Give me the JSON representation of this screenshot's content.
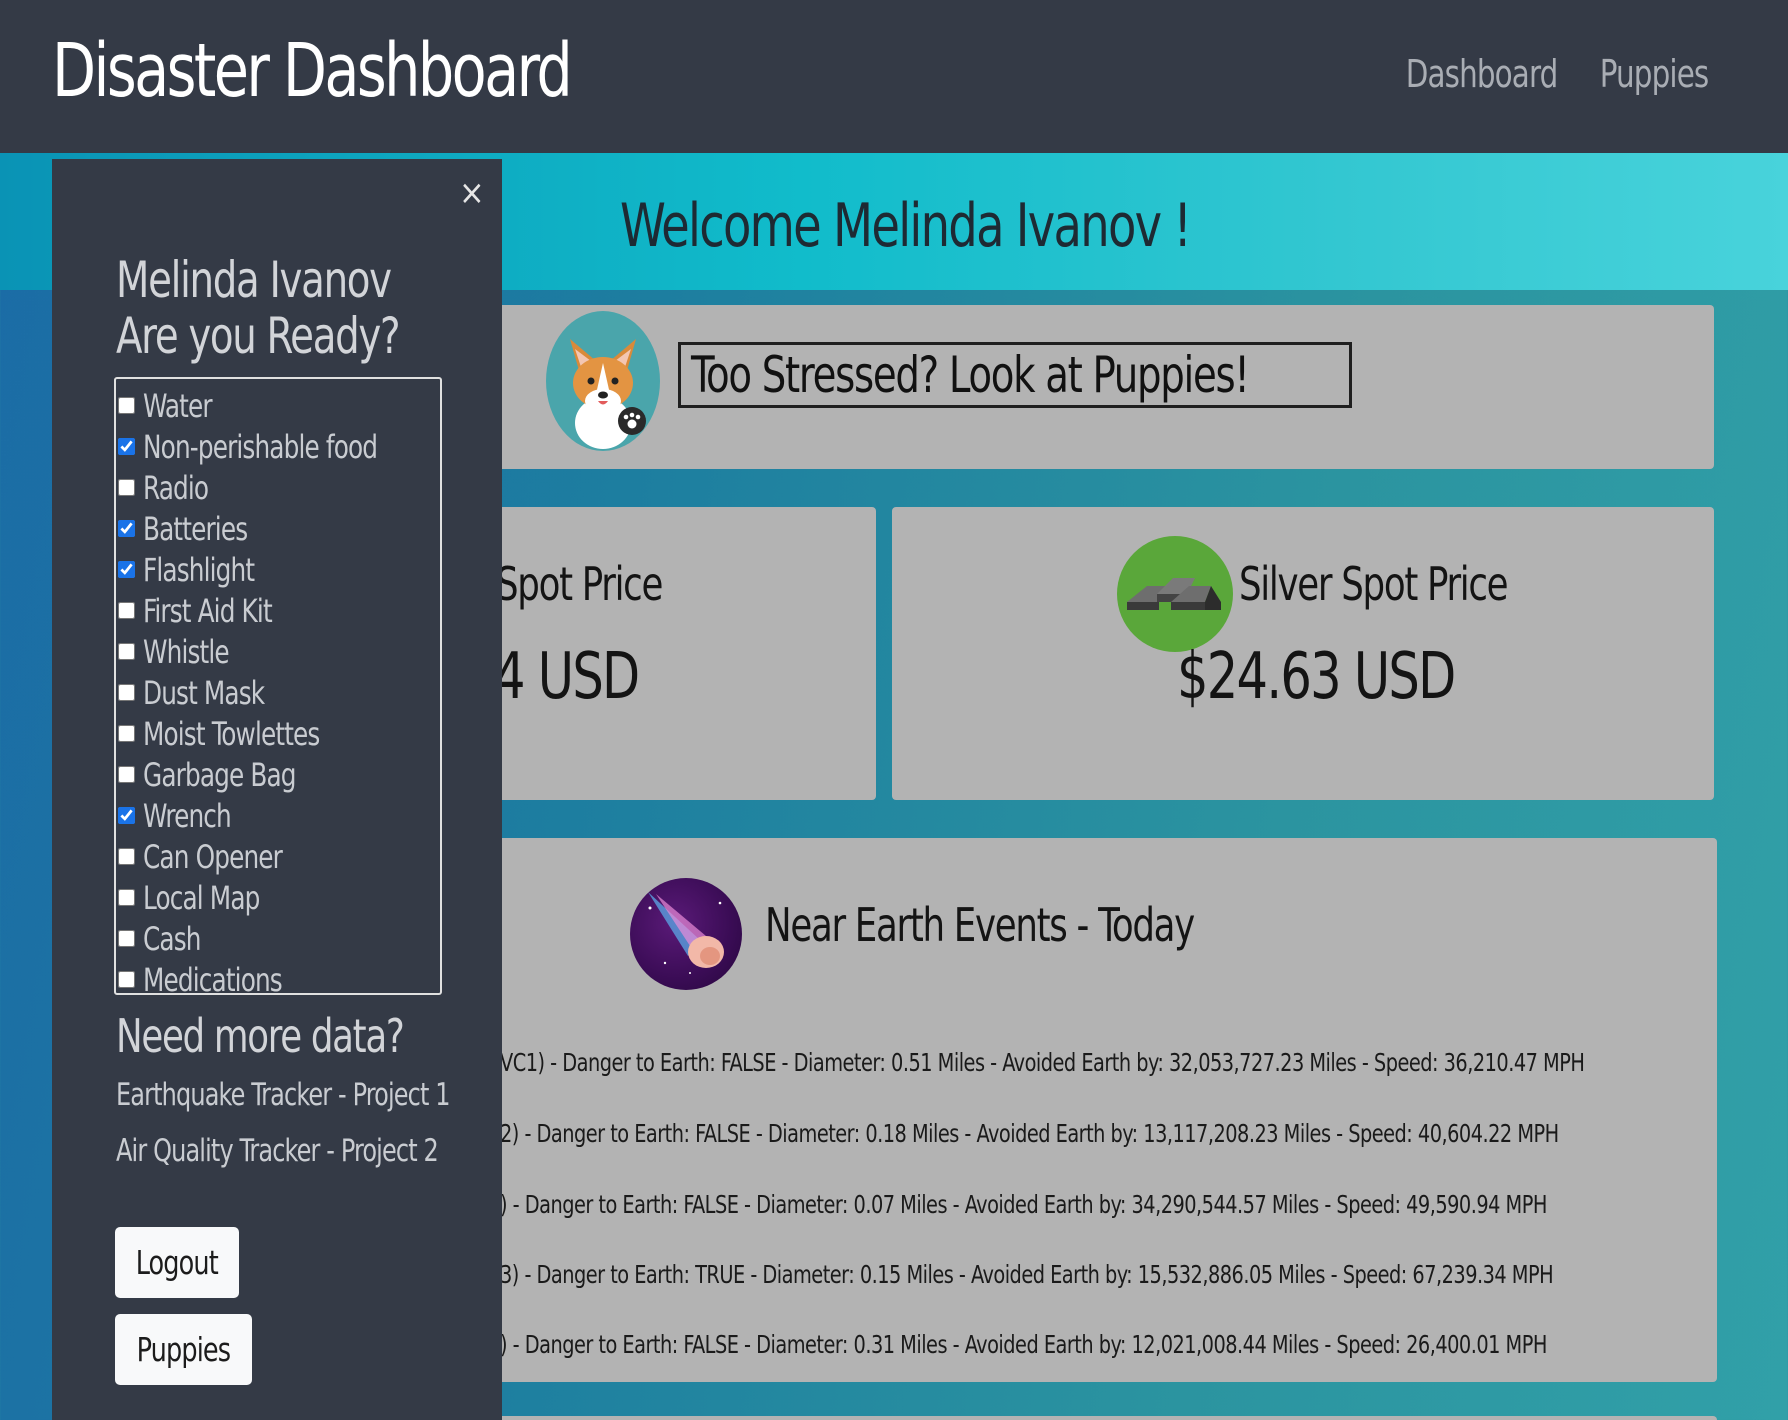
{
  "navbar": {
    "brand": "Disaster Dashboard",
    "links": [
      "Dashboard",
      "Puppies"
    ]
  },
  "welcome": "Welcome Melinda Ivanov !",
  "puppy_card": {
    "icon": "corgi-icon",
    "link_text": "Too Stressed? Look at Puppies!"
  },
  "gold_card": {
    "title": "Spot Price",
    "value": "4 USD"
  },
  "silver_card": {
    "icon": "silver-bars-icon",
    "title": "Silver Spot Price",
    "value": "$24.63 USD"
  },
  "neo_card": {
    "icon": "asteroid-icon",
    "title": "Near Earth Events - Today",
    "events": [
      "VC1) - Danger to Earth: FALSE - Diameter: 0.51 Miles - Avoided Earth by: 32,053,727.23 Miles - Speed: 36,210.47 MPH",
      "2) - Danger to Earth: FALSE - Diameter: 0.18 Miles - Avoided Earth by: 13,117,208.23 Miles - Speed: 40,604.22 MPH",
      ") - Danger to Earth: FALSE - Diameter: 0.07 Miles - Avoided Earth by: 34,290,544.57 Miles - Speed: 49,590.94 MPH",
      "3) - Danger to Earth: TRUE - Diameter: 0.15 Miles - Avoided Earth by: 15,532,886.05 Miles - Speed: 67,239.34 MPH",
      ") - Danger to Earth: FALSE - Diameter: 0.31 Miles - Avoided Earth by: 12,021,008.44 Miles - Speed: 26,400.01 MPH"
    ]
  },
  "sidebar": {
    "close_icon": "×",
    "user_name": "Melinda Ivanov",
    "ready_question": "Are you Ready?",
    "checklist": [
      {
        "label": "Water",
        "checked": false
      },
      {
        "label": "Non-perishable food",
        "checked": true
      },
      {
        "label": "Radio",
        "checked": false
      },
      {
        "label": "Batteries",
        "checked": true
      },
      {
        "label": "Flashlight",
        "checked": true
      },
      {
        "label": "First Aid Kit",
        "checked": false
      },
      {
        "label": "Whistle",
        "checked": false
      },
      {
        "label": "Dust Mask",
        "checked": false
      },
      {
        "label": "Moist Towlettes",
        "checked": false
      },
      {
        "label": "Garbage Bag",
        "checked": false
      },
      {
        "label": "Wrench",
        "checked": true
      },
      {
        "label": "Can Opener",
        "checked": false
      },
      {
        "label": "Local Map",
        "checked": false
      },
      {
        "label": "Cash",
        "checked": false
      },
      {
        "label": "Medications",
        "checked": false
      }
    ],
    "more_data_heading": "Need more data?",
    "links": [
      "Earthquake Tracker - Project 1",
      "Air Quality Tracker - Project 2"
    ],
    "logout_label": "Logout",
    "puppies_label": "Puppies"
  },
  "colors": {
    "navbar": "#343a46",
    "sidebar": "#343a46",
    "card": "#b3b3b3",
    "checkbox_accent": "#1a73e8"
  }
}
